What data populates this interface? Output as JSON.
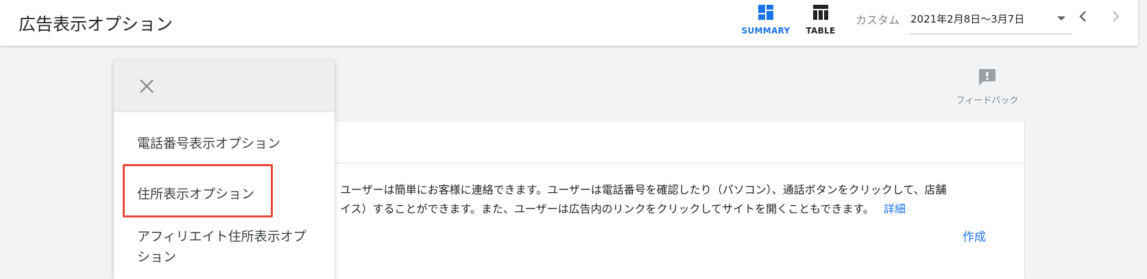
{
  "header": {
    "title": "広告表示オプション",
    "summary_label": "SUMMARY",
    "table_label": "TABLE",
    "custom_label": "カスタム",
    "date_range": "2021年2月8日〜3月7日"
  },
  "feedback": {
    "label": "フィードバック"
  },
  "card": {
    "description_line1": "ユーザーは簡単にお客様に連絡できます。ユーザーは電話番号を確認したり（パソコン）、通話ボタンをクリックして、店舗",
    "description_line2": "イス）することができます。また、ユーザーは広告内のリンクをクリックしてサイトを開くこともできます。",
    "details_link": "詳細",
    "create_link": "作成"
  },
  "panel": {
    "items": [
      {
        "label": "電話番号表示オプション"
      },
      {
        "label": "住所表示オプション"
      },
      {
        "label": "アフィリエイト住所表示オプション"
      }
    ]
  },
  "colors": {
    "accent": "#1a73e8",
    "highlight": "#e8483b",
    "background": "#f1f3f4"
  },
  "icons": {
    "summary": "dashboard-icon",
    "table": "table-icon",
    "dropdown": "caret-down-icon",
    "prev": "chevron-left-icon",
    "next": "chevron-right-icon",
    "feedback": "feedback-icon",
    "close": "close-icon"
  }
}
